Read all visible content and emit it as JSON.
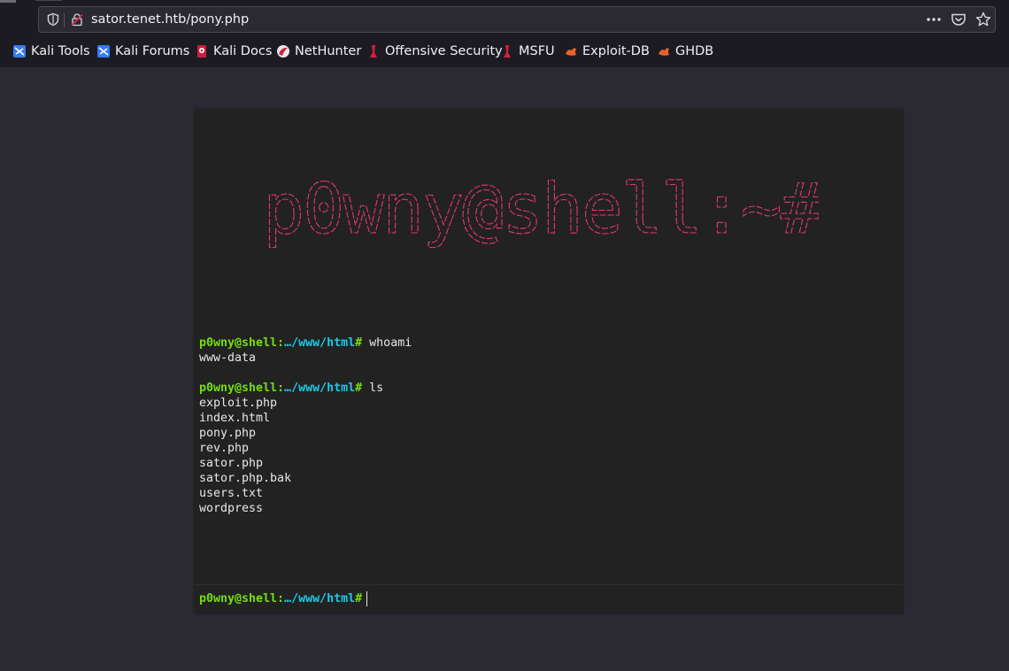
{
  "browser": {
    "url": "sator.tenet.htb/pony.php",
    "bookmarks": [
      {
        "label": "Kali Tools",
        "icon": "kali-dragon-icon"
      },
      {
        "label": "Kali Forums",
        "icon": "kali-dragon-icon"
      },
      {
        "label": "Kali Docs",
        "icon": "kali-docs-icon"
      },
      {
        "label": "NetHunter",
        "icon": "nethunter-icon"
      },
      {
        "label": "Offensive Security",
        "icon": "offsec-icon"
      },
      {
        "label": "MSFU",
        "icon": "offsec-icon"
      },
      {
        "label": "Exploit-DB",
        "icon": "exploitdb-icon"
      },
      {
        "label": "GHDB",
        "icon": "exploitdb-icon"
      }
    ]
  },
  "shell": {
    "banner_text": "p0wny@shell:~#",
    "banner_color": "#e5386a",
    "prompt_user": "p0wny@shell:",
    "prompt_path": "…/www/html",
    "prompt_suffix": "#",
    "prompt_color": "#75df0b",
    "path_color": "#1bc9e7",
    "history": [
      {
        "command": "whoami",
        "output": [
          "www-data"
        ]
      },
      {
        "command": "ls",
        "output": [
          "exploit.php",
          "index.html",
          "pony.php",
          "rev.php",
          "sator.php",
          "sator.php.bak",
          "users.txt",
          "wordpress"
        ]
      }
    ],
    "input_value": ""
  }
}
